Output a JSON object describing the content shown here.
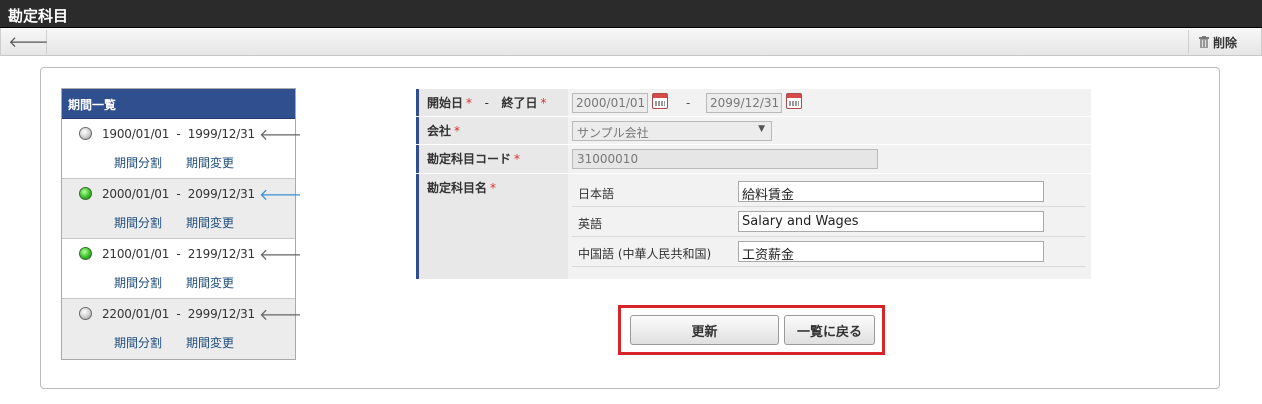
{
  "window": {
    "title": "勘定科目"
  },
  "toolbar": {
    "delete_label": "削除"
  },
  "period_list": {
    "title": "期間一覧",
    "link_split": "期間分割",
    "link_change": "期間変更",
    "items": [
      {
        "start": "1900/01/01",
        "end": "1999/12/31",
        "separator": "-",
        "status": "inactive",
        "selected": false
      },
      {
        "start": "2000/01/01",
        "end": "2099/12/31",
        "separator": "-",
        "status": "active",
        "selected": true
      },
      {
        "start": "2100/01/01",
        "end": "2199/12/31",
        "separator": "-",
        "status": "active",
        "selected": false
      },
      {
        "start": "2200/01/01",
        "end": "2999/12/31",
        "separator": "-",
        "status": "inactive",
        "selected": false
      }
    ]
  },
  "form": {
    "period": {
      "start_label": "開始日",
      "end_label": "終了日",
      "separator": "-",
      "start_value": "2000/01/01",
      "end_value": "2099/12/31"
    },
    "company": {
      "label": "会社",
      "value": "サンプル会社"
    },
    "code": {
      "label": "勘定科目コード",
      "value": "31000010"
    },
    "name": {
      "label": "勘定科目名",
      "languages": [
        {
          "name": "日本語",
          "value": "給料賃金"
        },
        {
          "name": "英語",
          "value": "Salary and Wages"
        },
        {
          "name": "中国語 (中華人民共和国)",
          "value": "工资薪金"
        }
      ]
    },
    "required_mark": "*"
  },
  "actions": {
    "update_label": "更新",
    "back_label": "一覧に戻る"
  },
  "colors": {
    "header_blue": "#2f4f8f",
    "required_red": "#d9312b",
    "highlight_red": "#d7242b",
    "link_blue": "#1f4d7e"
  }
}
